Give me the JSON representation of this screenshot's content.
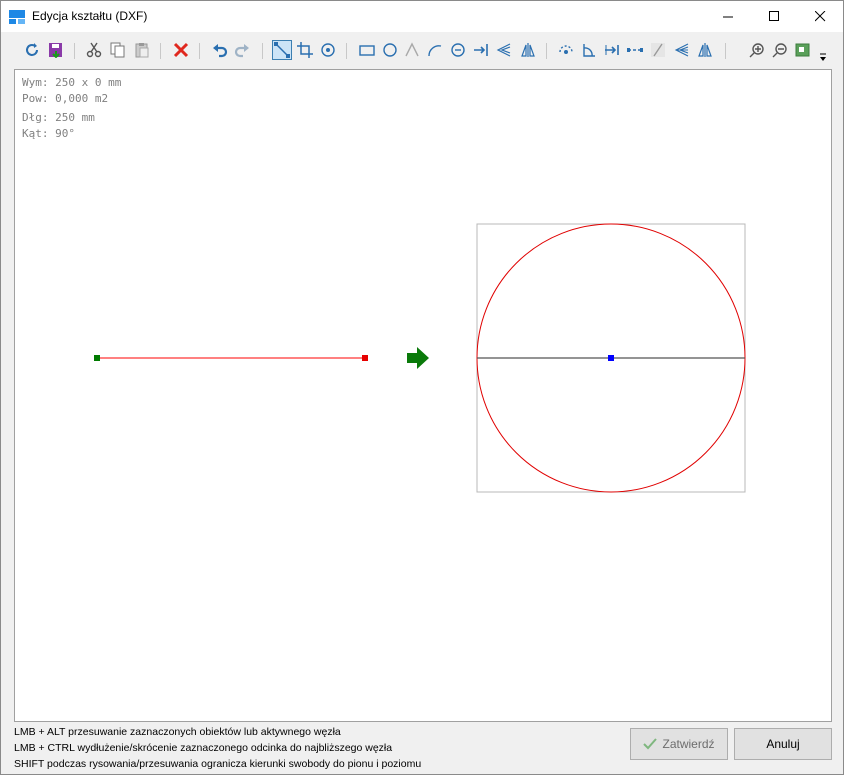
{
  "window": {
    "title": "Edycja kształtu (DXF)"
  },
  "toolbar": {
    "buttons": [
      "refresh-icon",
      "save-icon",
      "cut-icon",
      "copy-icon",
      "paste-icon",
      "delete-icon",
      "undo-icon",
      "redo-icon",
      "line-tool-icon",
      "crop-tool-icon",
      "rotate-tool-icon",
      "rectangle-icon",
      "circle-icon",
      "polyline-icon",
      "arc-icon",
      "circle-3pt-icon",
      "extend-icon",
      "mirror-h-icon",
      "mirror-v-icon",
      "rotate-node-icon",
      "angle-icon",
      "dimension-icon",
      "offset-icon",
      "trim-icon",
      "hatch-icon",
      "flip-icon",
      "zoom-in-icon",
      "zoom-out-icon",
      "fit-icon",
      "dropdown-icon"
    ]
  },
  "info": {
    "dimensions": "Wym: 250 x 0 mm",
    "area": "Pow: 0,000 m2",
    "length": "Dłg: 250 mm",
    "angle": "Kąt: 90°"
  },
  "status": {
    "line1": "LMB + ALT przesuwanie zaznaczonych obiektów lub aktywnego węzła",
    "line2": "LMB + CTRL wydłużenie/skrócenie zaznaczonego odcinka do najbliższego węzła",
    "line3": "SHIFT podczas rysowania/przesuwania ogranicza kierunki swobody do pionu i poziomu"
  },
  "buttons": {
    "confirm": "Zatwierdź",
    "cancel": "Anuluj"
  },
  "colors": {
    "shape": "#ff0000",
    "start_node": "#007a00",
    "end_node": "#e60000",
    "center_node": "#0000ff",
    "arrow": "#0a7a0a"
  }
}
